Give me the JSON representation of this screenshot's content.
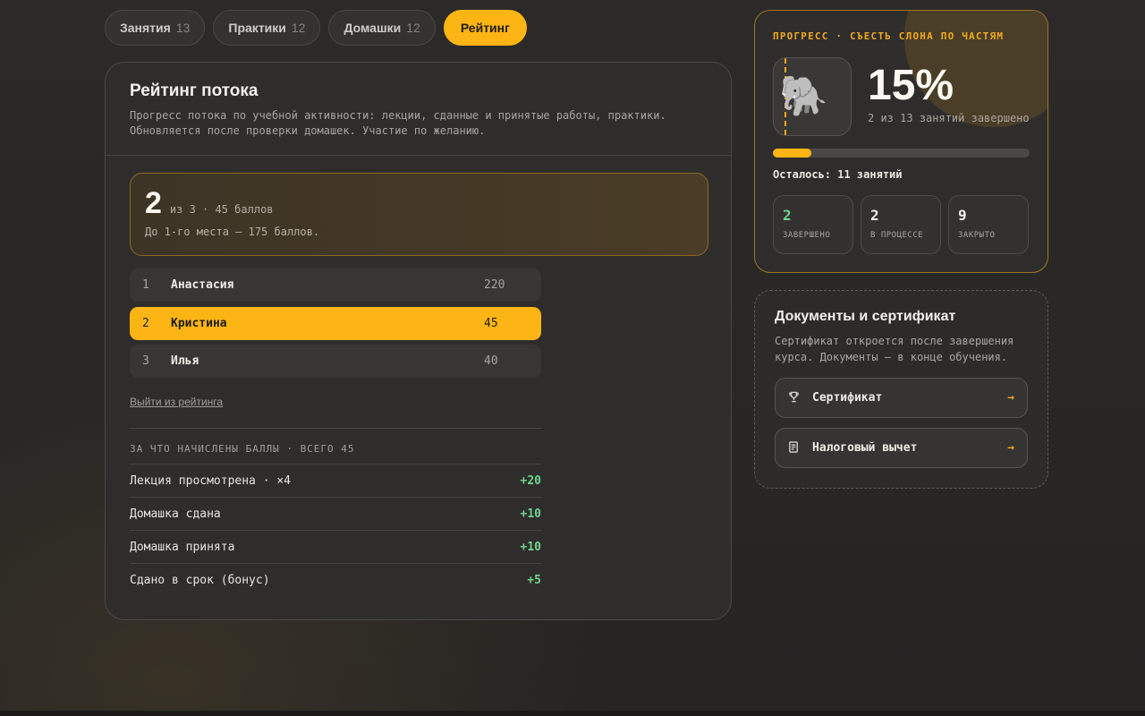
{
  "tabs": [
    {
      "label": "Занятия",
      "count": "13"
    },
    {
      "label": "Практики",
      "count": "12"
    },
    {
      "label": "Домашки",
      "count": "12"
    },
    {
      "label": "Рейтинг",
      "count": ""
    }
  ],
  "rating": {
    "title": "Рейтинг потока",
    "description": "Прогресс потока по учебной активности: лекции, сданные и принятые работы, практики. Обновляется после проверки домашек. Участие по желанию.",
    "standing": {
      "place": "2",
      "meta": "из 3 · 45 баллов",
      "gap": "До 1-го места — 175 баллов."
    },
    "leaderboard": [
      {
        "rank": "1",
        "name": "Анастасия",
        "points": "220"
      },
      {
        "rank": "2",
        "name": "Кристина",
        "points": "45"
      },
      {
        "rank": "3",
        "name": "Илья",
        "points": "40"
      }
    ],
    "leave_label": "Выйти из рейтинга",
    "breakdown_title": "ЗА ЧТО НАЧИСЛЕНЫ БАЛЛЫ · ВСЕГО 45",
    "breakdown": [
      {
        "label": "Лекция просмотрена · ×4",
        "points": "+20"
      },
      {
        "label": "Домашка сдана",
        "points": "+10"
      },
      {
        "label": "Домашка принята",
        "points": "+10"
      },
      {
        "label": "Сдано в срок (бонус)",
        "points": "+5"
      }
    ]
  },
  "progress": {
    "label": "ПРОГРЕСС · СЪЕСТЬ СЛОНА ПО ЧАСТЯМ",
    "percent_text": "15%",
    "fraction": 0.15,
    "subtitle": "2 из 13 занятий завершено",
    "remaining": "Осталось: 11 занятий",
    "illustration_icon": "elephant-icon",
    "stats": [
      {
        "value": "2",
        "label": "ЗАВЕРШЕНО"
      },
      {
        "value": "2",
        "label": "В ПРОЦЕССЕ"
      },
      {
        "value": "9",
        "label": "ЗАКРЫТО"
      }
    ]
  },
  "documents": {
    "title": "Документы и сертификат",
    "description": "Сертификат откроется после завершения курса. Документы — в конце обучения.",
    "items": [
      {
        "icon": "trophy-icon",
        "label": "Сертификат",
        "arrow": "→"
      },
      {
        "icon": "document-icon",
        "label": "Налоговый вычет",
        "arrow": "→"
      }
    ]
  },
  "colors": {
    "accent": "#fdb515",
    "positive": "#6fd38f",
    "background": "#2a2827"
  }
}
